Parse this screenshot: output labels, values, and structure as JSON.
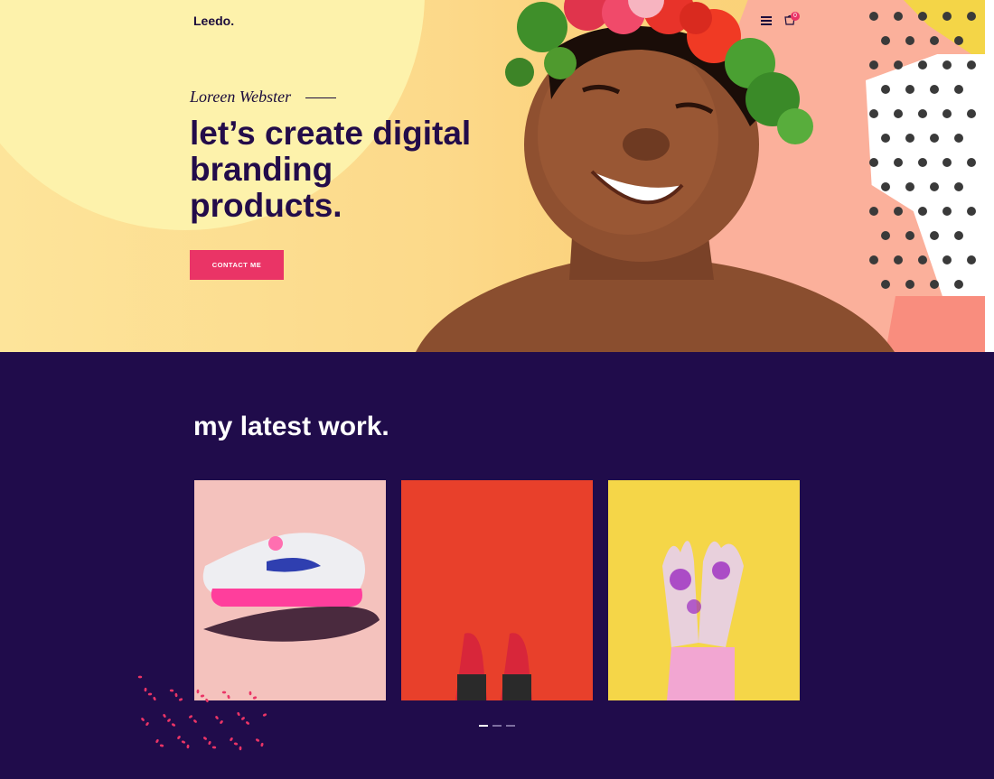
{
  "brand": {
    "logo": "Leedo."
  },
  "header": {
    "menu_icon": "hamburger-icon",
    "cart_icon": "cart-icon",
    "cart_count": "0"
  },
  "hero": {
    "subtitle": "Loreen Webster",
    "headline": "let’s create digital branding products.",
    "cta_label": "CONTACT ME"
  },
  "work": {
    "title": "my latest work.",
    "items": [
      {
        "name": "sneaker-on-hand",
        "bg": "#f4c2bd"
      },
      {
        "name": "red-sneakers-on-red",
        "bg": "#e8402b"
      },
      {
        "name": "purple-paint-hands",
        "bg": "#f5d648"
      }
    ],
    "pagination": {
      "pages": 3,
      "active": 0
    }
  },
  "colors": {
    "accent": "#ea3466",
    "navy": "#200c4b",
    "heading": "#230c4a",
    "hero_yellow": "#fcd98a",
    "hero_circle": "#fdf2ab",
    "pink": "#fbb09b"
  }
}
